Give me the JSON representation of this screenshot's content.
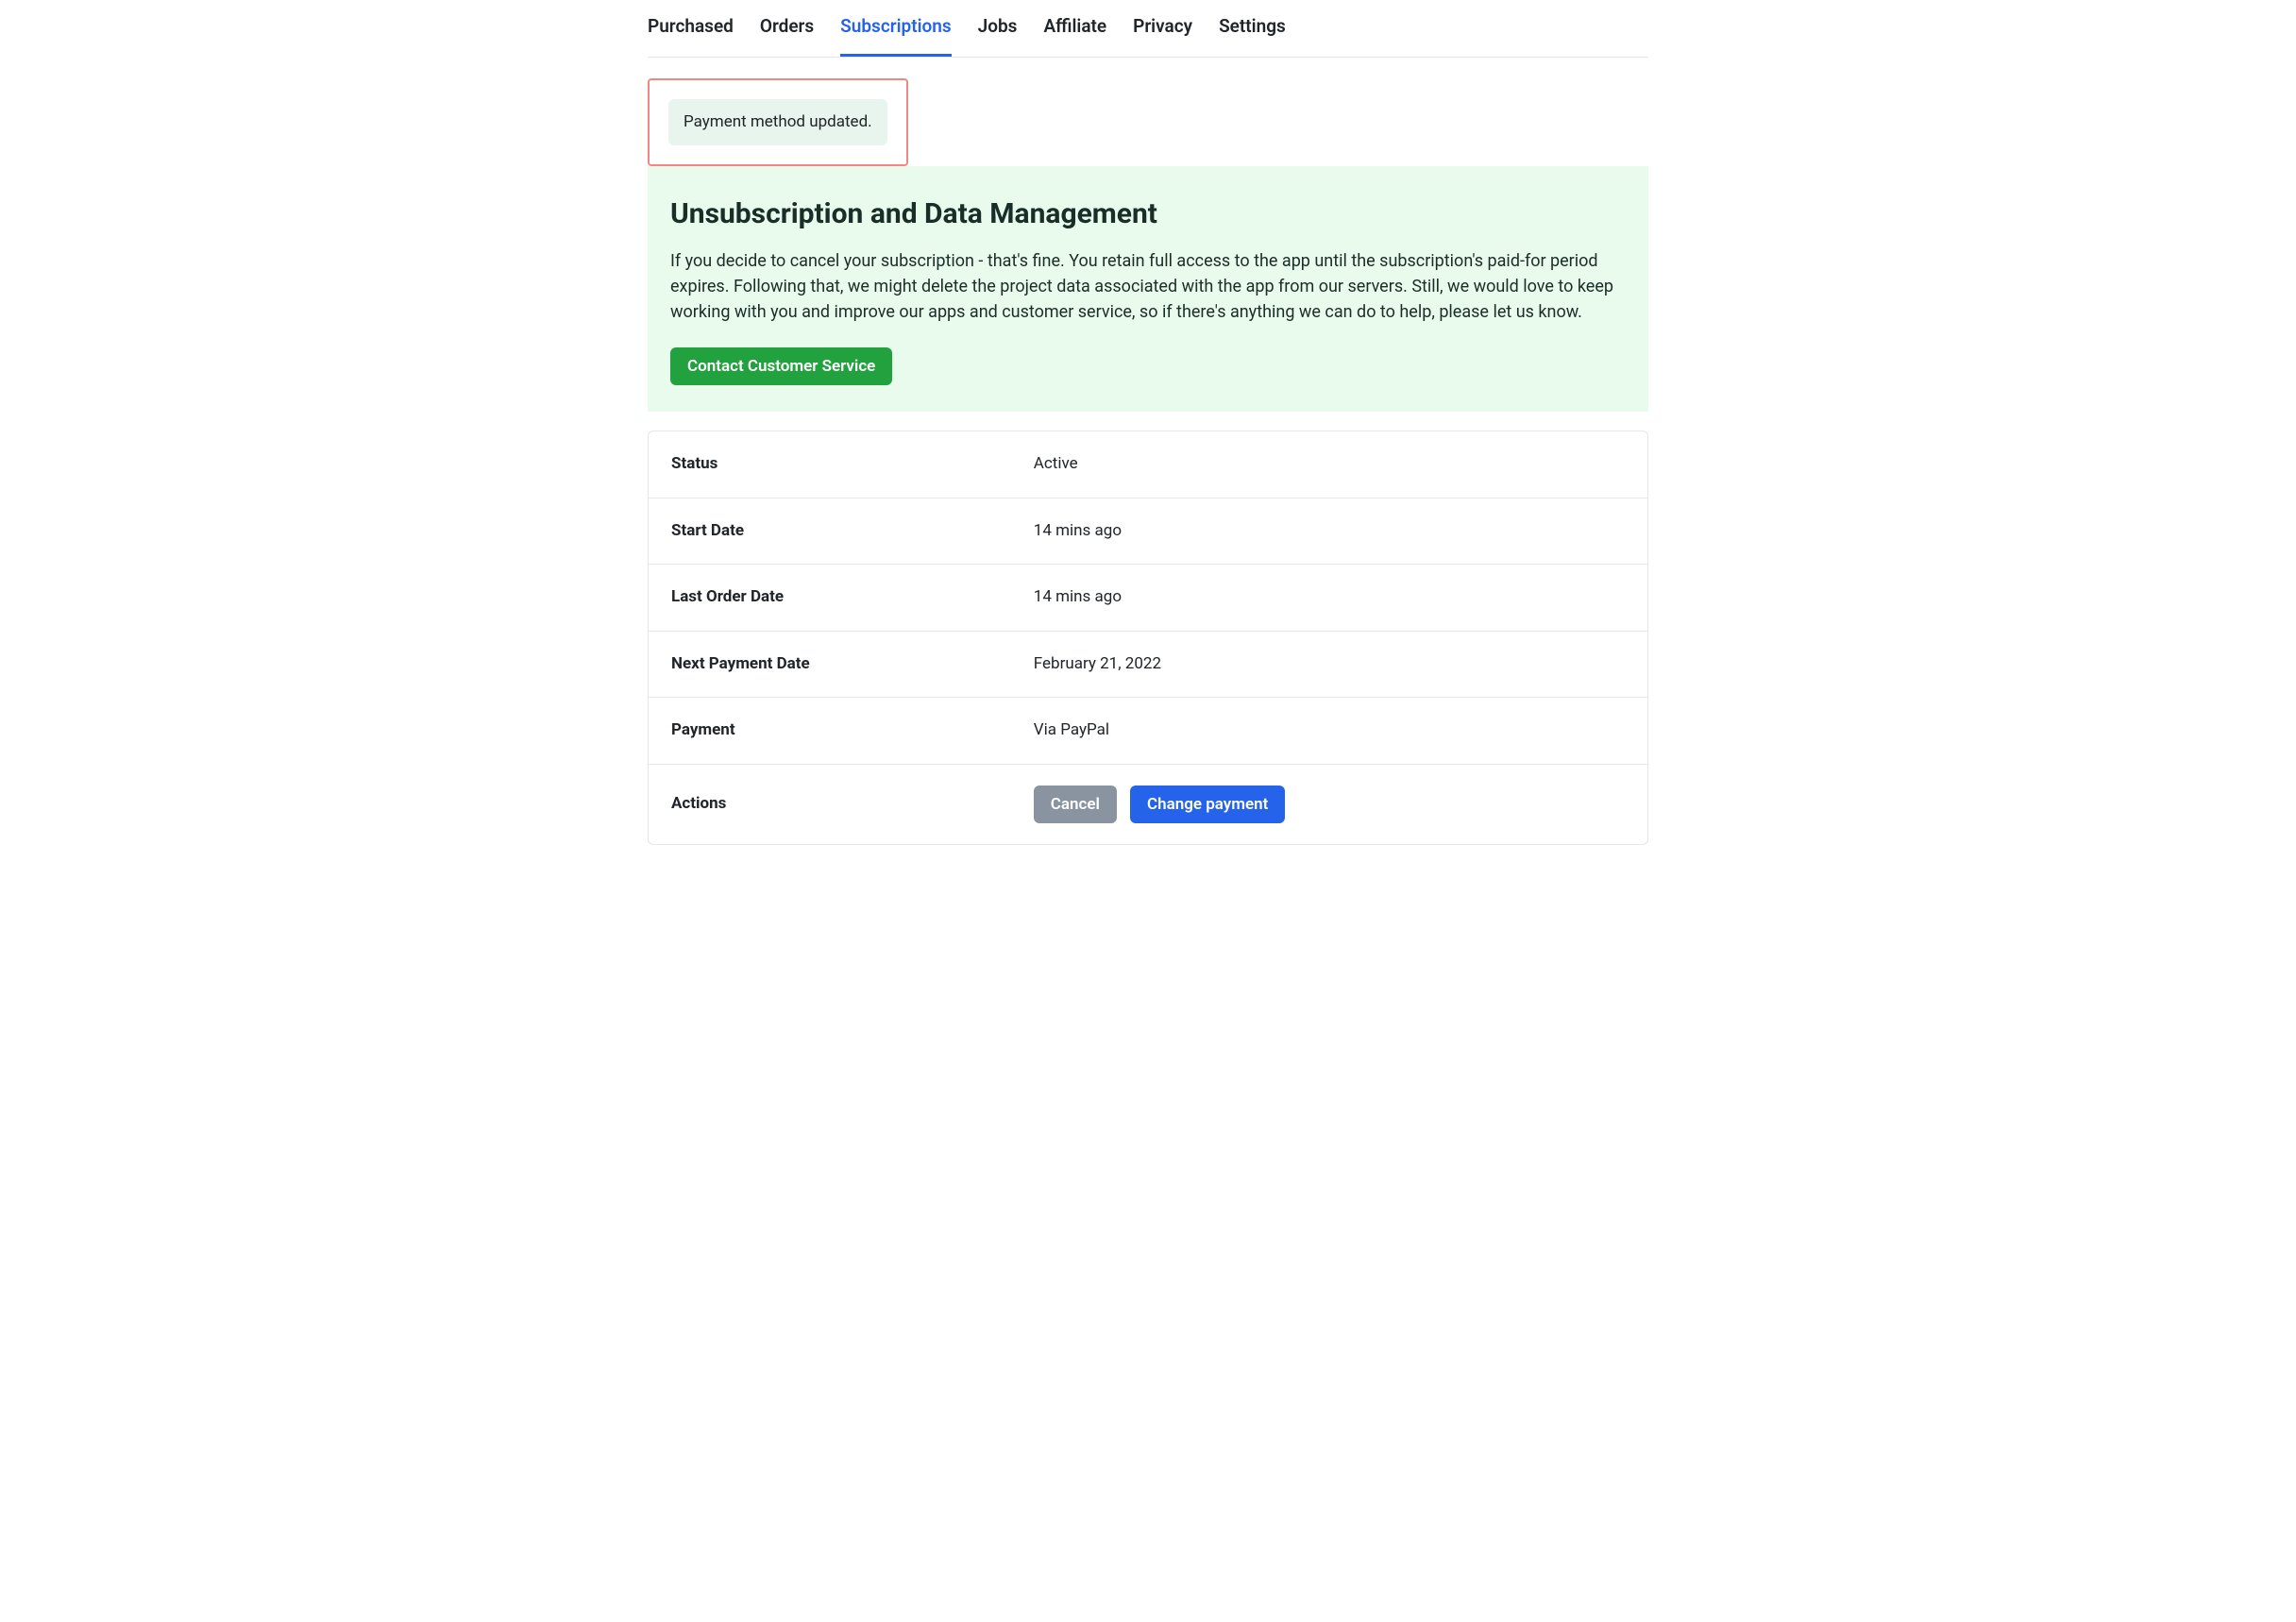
{
  "tabs": {
    "items": [
      {
        "label": "Purchased",
        "active": false
      },
      {
        "label": "Orders",
        "active": false
      },
      {
        "label": "Subscriptions",
        "active": true
      },
      {
        "label": "Jobs",
        "active": false
      },
      {
        "label": "Affiliate",
        "active": false
      },
      {
        "label": "Privacy",
        "active": false
      },
      {
        "label": "Settings",
        "active": false
      }
    ]
  },
  "alert": {
    "message": "Payment method updated."
  },
  "info_panel": {
    "heading": "Unsubscription and Data Management",
    "body": "If you decide to cancel your subscription - that's fine. You retain full access to the app until the subscription's paid-for period expires. Following that, we might delete the project data associated with the app from our servers. Still, we would love to keep working with you and improve our apps and customer service, so if there's anything we can do to help, please let us know.",
    "button_label": "Contact Customer Service"
  },
  "details": {
    "status": {
      "label": "Status",
      "value": "Active"
    },
    "start_date": {
      "label": "Start Date",
      "value": "14 mins ago"
    },
    "last_order_date": {
      "label": "Last Order Date",
      "value": "14 mins ago"
    },
    "next_payment_date": {
      "label": "Next Payment Date",
      "value": "February 21, 2022"
    },
    "payment": {
      "label": "Payment",
      "value": "Via PayPal"
    },
    "actions": {
      "label": "Actions",
      "cancel_button": "Cancel",
      "change_payment_button": "Change payment"
    }
  }
}
